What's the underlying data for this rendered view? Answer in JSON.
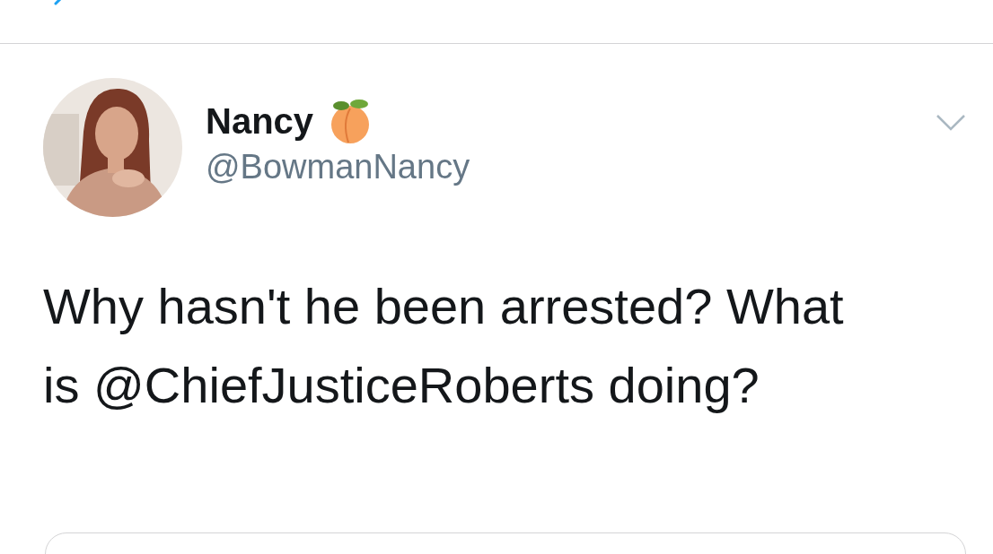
{
  "tweet": {
    "author": {
      "name": "Nancy",
      "handle": "@BowmanNancy"
    },
    "text": "Why hasn't he been arrested? What is @ChiefJusticeRoberts doing?"
  }
}
